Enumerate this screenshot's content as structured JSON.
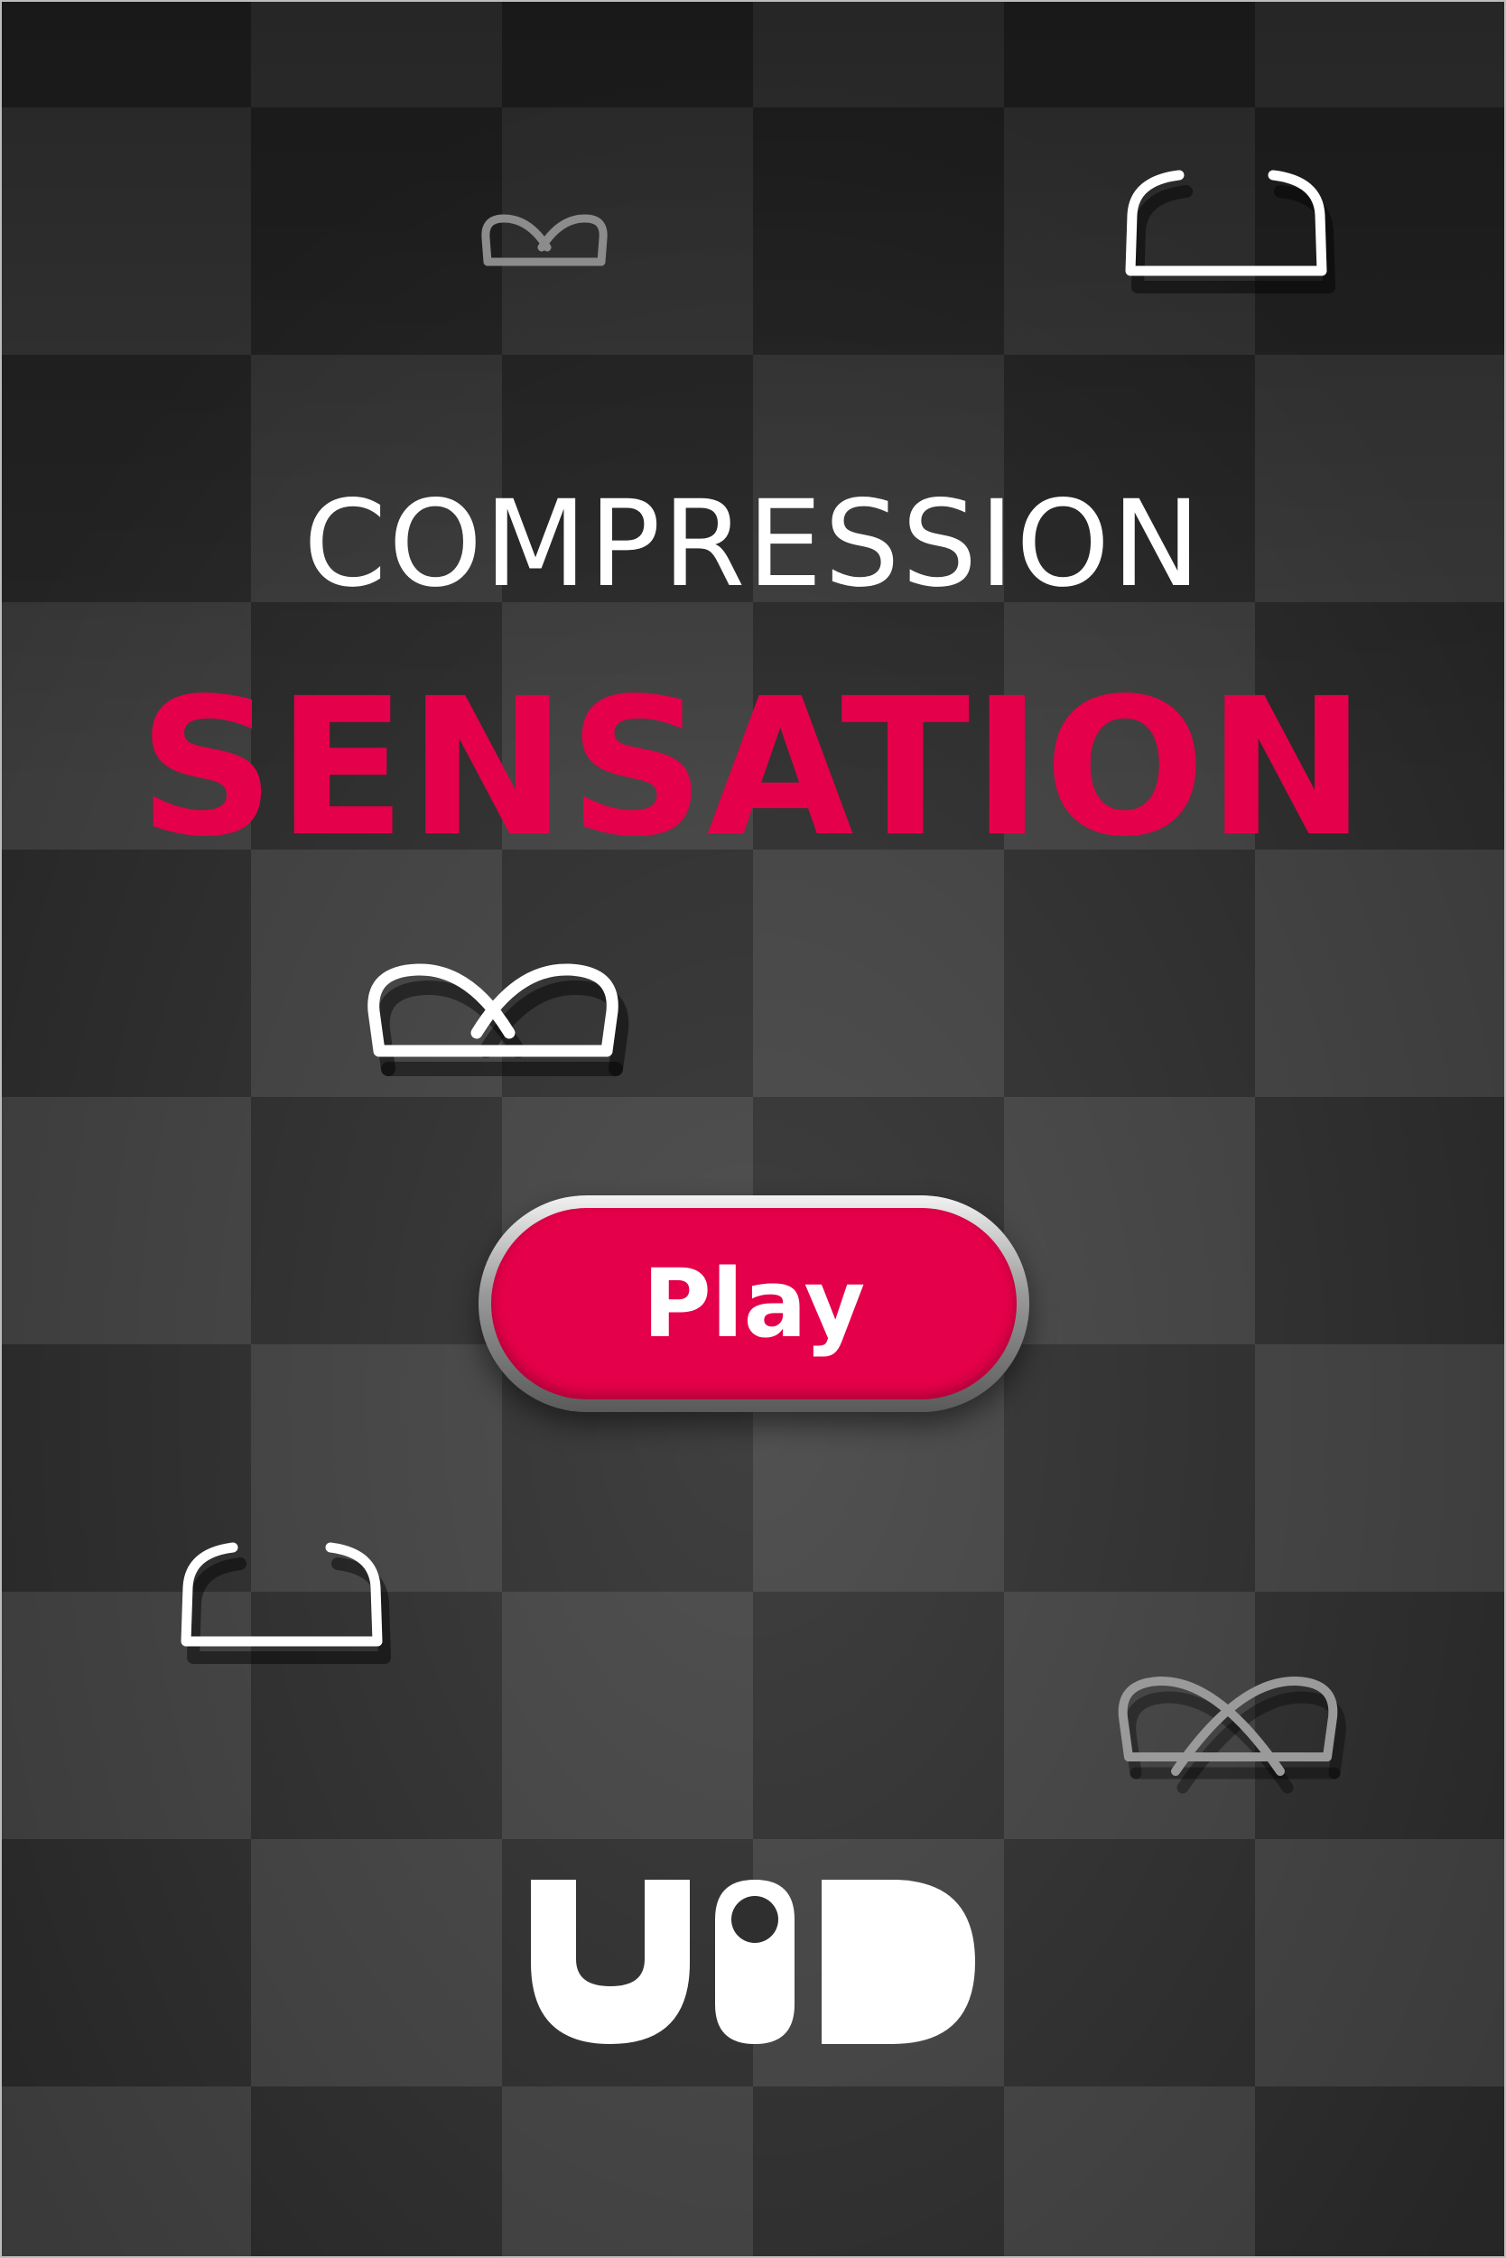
{
  "title": {
    "line1": "COMPRESSION",
    "line2": "SENSATION"
  },
  "play_button": {
    "label": "Play"
  },
  "logo": {
    "icon": "uid-logo"
  },
  "pieces": [
    {
      "name": "u-piece-icon",
      "variant": "open",
      "tone": "bright"
    },
    {
      "name": "u-piece-icon",
      "variant": "open",
      "tone": "bright"
    },
    {
      "name": "twisted-piece-icon",
      "variant": "crossed",
      "tone": "dim"
    },
    {
      "name": "twisted-piece-icon",
      "variant": "crossed",
      "tone": "bright"
    },
    {
      "name": "twisted-piece-icon",
      "variant": "crossed-deep",
      "tone": "dim"
    }
  ],
  "colors": {
    "accent": "#e4004a",
    "text_light": "#ffffff",
    "board_dark": "#262626",
    "board_light": "#3a3a3a"
  }
}
